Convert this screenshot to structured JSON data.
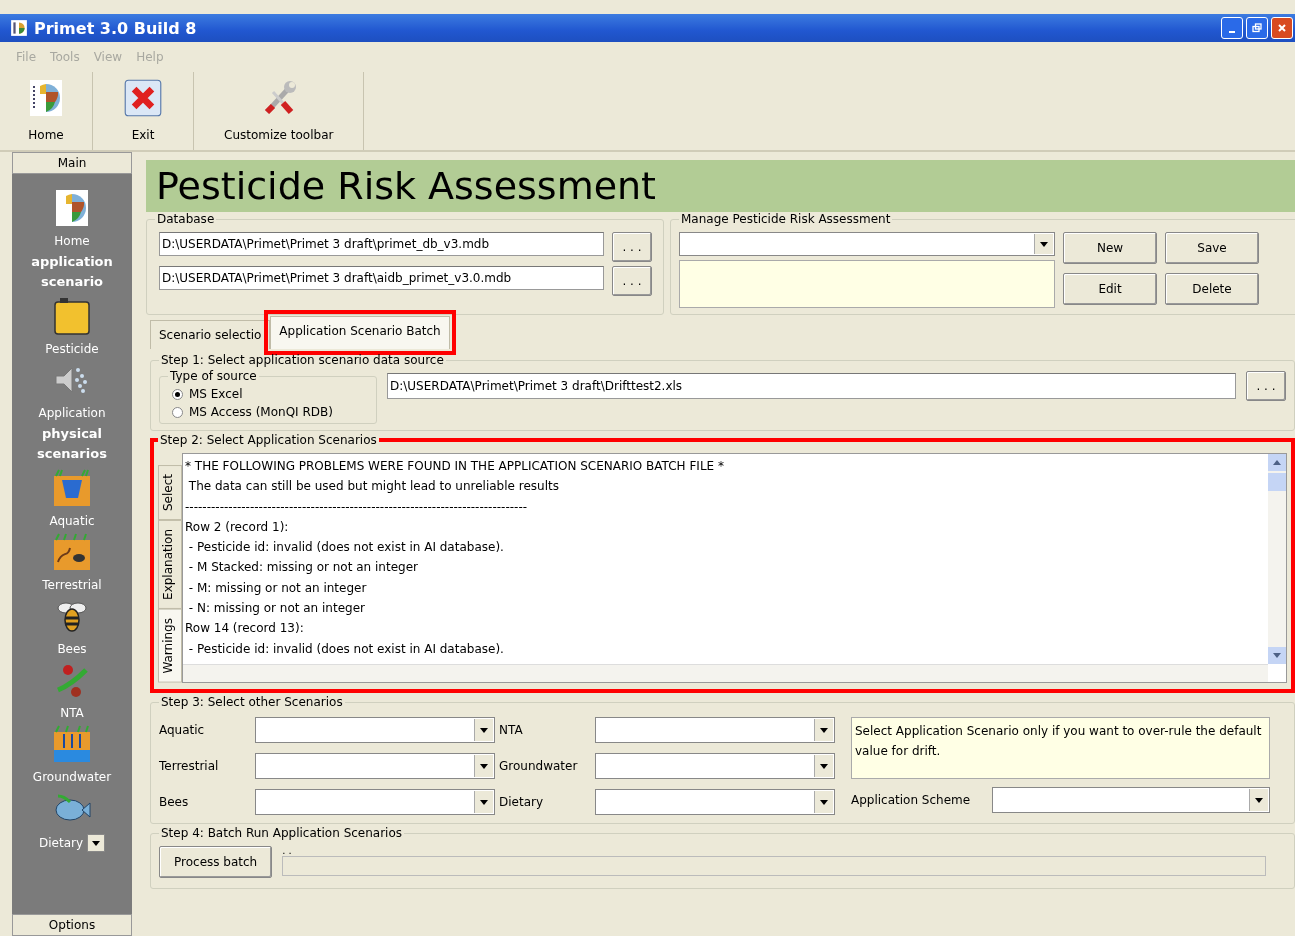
{
  "window": {
    "title": "Primet 3.0 Build 8"
  },
  "menu": [
    "File",
    "Tools",
    "View",
    "Help"
  ],
  "toolbar": [
    {
      "label": "Home",
      "kind": "home"
    },
    {
      "label": "Exit",
      "kind": "exit"
    },
    {
      "label": "Customize toolbar",
      "kind": "tools"
    }
  ],
  "sidebar": {
    "header": "Main",
    "footer": "Options",
    "items": [
      {
        "kind": "home",
        "label": "Home"
      },
      {
        "kind": "heading",
        "label": "application scenario"
      },
      {
        "kind": "pesticide",
        "label": "Pesticide"
      },
      {
        "kind": "application",
        "label": "Application"
      },
      {
        "kind": "heading",
        "label": "physical scenarios"
      },
      {
        "kind": "aquatic",
        "label": "Aquatic"
      },
      {
        "kind": "terrestrial",
        "label": "Terrestrial"
      },
      {
        "kind": "bees",
        "label": "Bees"
      },
      {
        "kind": "nta",
        "label": "NTA"
      },
      {
        "kind": "groundwater",
        "label": "Groundwater"
      },
      {
        "kind": "dietary",
        "label": "Dietary"
      }
    ]
  },
  "page_title": "Pesticide Risk Assessment",
  "database": {
    "legend": "Database",
    "paths": [
      {
        "value": "D:\\USERDATA\\Primet\\Primet 3 draft\\primet_db_v3.mdb",
        "button": ". . ."
      },
      {
        "value": "D:\\USERDATA\\Primet\\Primet 3 draft\\aidb_primet_v3.0.mdb",
        "button": ". . ."
      }
    ]
  },
  "manage": {
    "legend": "Manage Pesticide Risk Assessment",
    "buttons": [
      "New",
      "Save",
      "Edit",
      "Delete"
    ]
  },
  "tabs": [
    {
      "label": "Scenario selectio",
      "selected": false,
      "highlighted": false
    },
    {
      "label": "Application Scenario Batch",
      "selected": true,
      "highlighted": true
    }
  ],
  "step1": {
    "legend": "Step 1: Select application scenario data source",
    "source_legend": "Type of source",
    "options": [
      {
        "label": "MS Excel",
        "selected": true
      },
      {
        "label": "MS Access (MonQI RDB)",
        "selected": false
      }
    ],
    "file_path": "D:\\USERDATA\\Primet\\Primet 3 draft\\Drifttest2.xls",
    "button": ". . ."
  },
  "step2": {
    "legend": "Step 2: Select Application Scenarios",
    "highlighted": true,
    "side_tabs": [
      {
        "label": "Select",
        "selected": false
      },
      {
        "label": "Explanation",
        "selected": false
      },
      {
        "label": "Warnings",
        "selected": true
      }
    ],
    "log_lines": [
      "* THE FOLLOWING PROBLEMS WERE FOUND IN THE APPLICATION SCENARIO BATCH FILE *",
      " The data can still be used but might lead to unreliable results",
      "-------------------------------------------------------------------------------",
      "Row 2 (record 1):",
      " - Pesticide id: invalid (does not exist in AI database).",
      " - M Stacked: missing or not an integer",
      " - M: missing or not an integer",
      " - N: missing or not an integer",
      "Row 14 (record 13):",
      " - Pesticide id: invalid (does not exist in AI database)."
    ]
  },
  "step3": {
    "legend": "Step 3: Select other Scenarios",
    "fields": [
      {
        "label": "Aquatic"
      },
      {
        "label": "NTA"
      },
      {
        "label": "Terrestrial"
      },
      {
        "label": "Groundwater"
      },
      {
        "label": "Bees"
      },
      {
        "label": "Dietary"
      }
    ],
    "note": "Select Application Scenario only if you want to over-rule the default value for drift.",
    "scheme_label": "Application Scheme"
  },
  "step4": {
    "legend": "Step 4: Batch Run Application Scenarios",
    "button": "Process batch",
    "progress": {
      "caption": ". .",
      "level": 0
    }
  }
}
